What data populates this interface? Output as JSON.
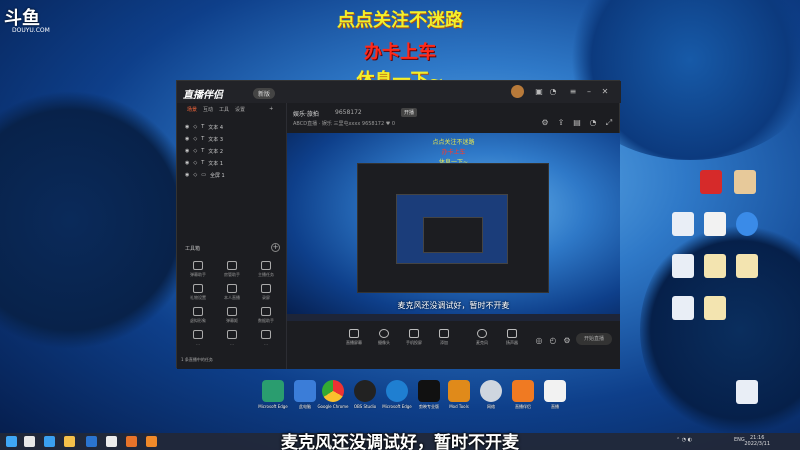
{
  "watermark": {
    "mark": "斗鱼",
    "sub": "DOUYU.COM"
  },
  "overlay": {
    "line1": "点点关注不迷路",
    "line2": "办卡上车",
    "line3": "休息一下~"
  },
  "colors": {
    "line1": "#f3ef2a",
    "line2": "#ff2a1a",
    "line3": "#f3ef2a",
    "accent": "#ff6a3c"
  },
  "app": {
    "brand": "直播伴侣",
    "brand_tag": "新版",
    "tabs": [
      "场景",
      "互动",
      "工具",
      "设置"
    ],
    "layers": [
      {
        "label": "文本 4",
        "icon": "eye-icon"
      },
      {
        "label": "文本 3",
        "icon": "eye-icon"
      },
      {
        "label": "文本 2",
        "icon": "eye-icon"
      },
      {
        "label": "文本 1",
        "icon": "eye-icon"
      },
      {
        "label": "全屏 1",
        "icon": "eye-icon"
      }
    ],
    "tools_title": "工具箱",
    "tools": [
      "弹幕助手",
      "房管助手",
      "主播任务",
      "礼物设置",
      "本人直播",
      "录屏",
      "虚拟形象",
      "弹幕姬",
      "数据助手",
      "…",
      "…",
      "…"
    ],
    "footer": "1 条直播中的任务",
    "room_title": "娱乐·旅拍",
    "room_id": "9658172",
    "room_btn": "开播",
    "sub_info": "ABCD直播 · 娱乐    三里屯xxxx    9658172    ♥ 0",
    "preview": {
      "l1": "点点关注不迷路",
      "l2": "办卡上车",
      "l3": "休息一下~",
      "subtitle": "麦克风还没调试好，暂时不开麦"
    },
    "controls": [
      "直播屏幕",
      "摄像头",
      "手机投屏",
      "添加",
      "麦克风",
      "扬声器"
    ],
    "live_btn": "开始直播"
  },
  "desktop": {
    "right_icons": [
      "图",
      "图",
      "文件",
      "文件",
      "文件",
      "文件",
      "文件",
      "文件",
      "文件",
      "文件",
      "文件"
    ],
    "dock": [
      "Microsoft Edge",
      "此电脑",
      "Google Chrome",
      "OBS Studio",
      "Microsoft Edge",
      "剪映专业版",
      "Mod Tools",
      "网络",
      "直播伴侣",
      "直播"
    ]
  },
  "subtitle": "麦克风还没调试好，暂时不开麦",
  "taskbar": {
    "lang": "ENG",
    "time": "21:16",
    "date": "2022/3/11"
  }
}
